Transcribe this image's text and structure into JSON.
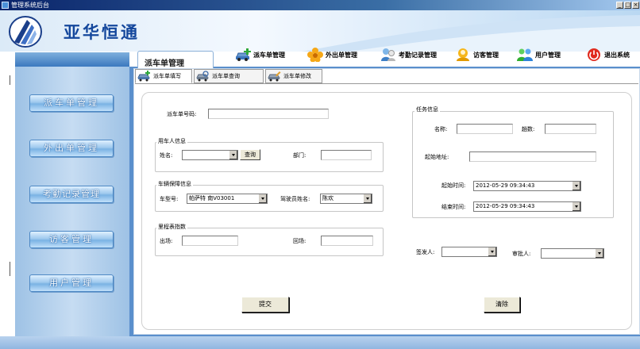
{
  "window": {
    "title": "管理系统后台"
  },
  "brand": {
    "name": "亚华恒通"
  },
  "menu": {
    "current_page": "派车单管理",
    "items": [
      {
        "id": "dispatch",
        "label": "派车单管理",
        "icon": "car-icon"
      },
      {
        "id": "outbound",
        "label": "外出单管理",
        "icon": "flower-icon"
      },
      {
        "id": "attendance",
        "label": "考勤记录管理",
        "icon": "people-icon"
      },
      {
        "id": "visitor",
        "label": "访客管理",
        "icon": "visitor-icon"
      },
      {
        "id": "users",
        "label": "用户管理",
        "icon": "users-icon"
      },
      {
        "id": "exit",
        "label": "退出系统",
        "icon": "power-icon"
      }
    ]
  },
  "sidebar": {
    "items": [
      {
        "label": "派车单管理"
      },
      {
        "label": "外出单管理"
      },
      {
        "label": "考勤记录管理"
      },
      {
        "label": "访客管理"
      },
      {
        "label": "用户管理"
      }
    ]
  },
  "subtabs": [
    {
      "label": "派车单填写",
      "active": true
    },
    {
      "label": "派车单查询",
      "active": false
    },
    {
      "label": "派车单修改",
      "active": false
    }
  ],
  "form": {
    "dispatch_no": {
      "label": "派车单号码:",
      "value": ""
    },
    "user_group": {
      "title": "用车人信息",
      "name_label": "姓名:",
      "name_value": "",
      "query_button": "查询",
      "dept_label": "部门:",
      "dept_value": ""
    },
    "vehicle_group": {
      "title": "车辆保障信息",
      "model_label": "车型号:",
      "model_value": "帕萨特 南V03001",
      "driver_label": "驾驶员姓名:",
      "driver_value": "陈欢"
    },
    "odometer_group": {
      "title": "里程表指数",
      "out_label": "出场:",
      "out_value": "",
      "back_label": "回场:",
      "back_value": ""
    },
    "task_group": {
      "title": "任务信息",
      "name_label": "名称:",
      "name_value": "",
      "trips_label": "趟数:",
      "trips_value": "",
      "address_label": "起始地址:",
      "address_value": "",
      "start_label": "起始时间:",
      "start_value": "2012-05-29 09:34:43",
      "end_label": "结束时间:",
      "end_value": "2012-05-29 09:34:43"
    },
    "issuer_label": "签发人:",
    "issuer_value": "",
    "approver_label": "审批人:",
    "approver_value": "",
    "submit_button": "提交",
    "clear_button": "清除"
  },
  "colors": {
    "brand_blue": "#14479c",
    "sidebar": "#9ec2e5",
    "main_frame": "#5a8fcc"
  }
}
